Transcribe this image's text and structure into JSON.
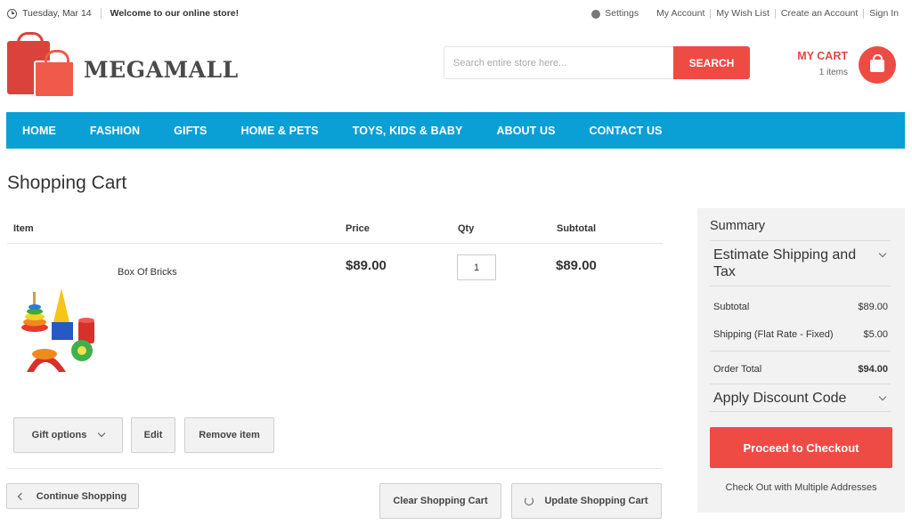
{
  "topbar": {
    "date": "Tuesday, Mar 14",
    "welcome": "Welcome to our online store!",
    "settings": "Settings",
    "links": [
      "My Account",
      "My Wish List",
      "Create an Account",
      "Sign In"
    ]
  },
  "header": {
    "brand": "MEGAMALL",
    "search_placeholder": "Search entire store here...",
    "search_button": "SEARCH",
    "cart_title": "MY CART",
    "cart_count": "1 items"
  },
  "nav": [
    "HOME",
    "FASHION",
    "GIFTS",
    "HOME & PETS",
    "TOYS, KIDS & BABY",
    "ABOUT US",
    "CONTACT US"
  ],
  "page": {
    "title": "Shopping Cart"
  },
  "cart_table": {
    "headers": {
      "item": "Item",
      "price": "Price",
      "qty": "Qty",
      "subtotal": "Subtotal"
    },
    "rows": [
      {
        "name": "Box Of Bricks",
        "price": "$89.00",
        "qty": "1",
        "subtotal": "$89.00"
      }
    ],
    "item_actions": {
      "gift_options": "Gift options",
      "edit": "Edit",
      "remove": "Remove item"
    },
    "actions": {
      "continue": "Continue Shopping",
      "clear": "Clear Shopping Cart",
      "update": "Update Shopping Cart"
    }
  },
  "summary": {
    "title": "Summary",
    "estimate": "Estimate Shipping and Tax",
    "subtotal_label": "Subtotal",
    "subtotal_value": "$89.00",
    "shipping_label": "Shipping (Flat Rate - Fixed)",
    "shipping_value": "$5.00",
    "total_label": "Order Total",
    "total_value": "$94.00",
    "discount": "Apply Discount Code",
    "checkout": "Proceed to Checkout",
    "multi": "Check Out with Multiple Addresses"
  },
  "colors": {
    "accent": "#ef4b45",
    "nav": "#0a9fd5",
    "summary_bg": "#f2f2f2"
  }
}
